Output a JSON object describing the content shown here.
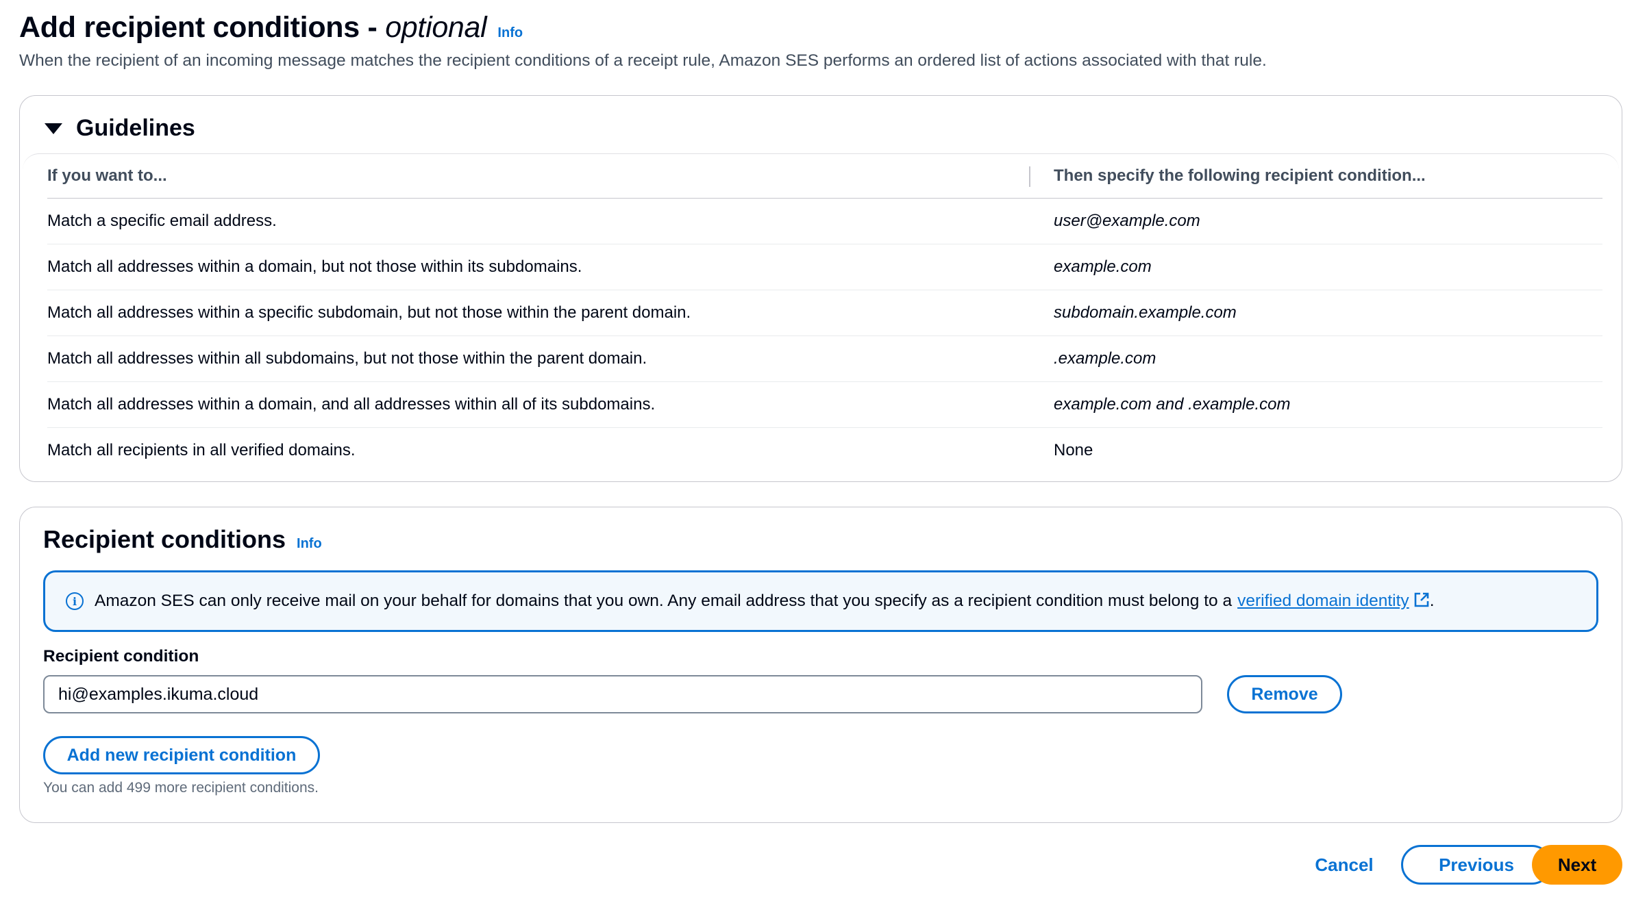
{
  "header": {
    "title_main": "Add recipient conditions - ",
    "title_optional": "optional",
    "info_label": "Info",
    "description": "When the recipient of an incoming message matches the recipient conditions of a receipt rule, Amazon SES performs an ordered list of actions associated with that rule."
  },
  "guidelines": {
    "title": "Guidelines",
    "columns": [
      "If you want to...",
      "Then specify the following recipient condition..."
    ],
    "rows": [
      {
        "want": "Match a specific email address.",
        "condition": "user@example.com"
      },
      {
        "want": "Match all addresses within a domain, but not those within its subdomains.",
        "condition": "example.com"
      },
      {
        "want": "Match all addresses within a specific subdomain, but not those within the parent domain.",
        "condition": "subdomain.example.com"
      },
      {
        "want": "Match all addresses within all subdomains, but not those within the parent domain.",
        "condition": ".example.com"
      },
      {
        "want": "Match all addresses within a domain, and all addresses within all of its subdomains.",
        "condition": "example.com and .example.com"
      },
      {
        "want": "Match all recipients in all verified domains.",
        "condition": "None"
      }
    ]
  },
  "conditions": {
    "title": "Recipient conditions",
    "info_label": "Info",
    "alert_text": "Amazon SES can only receive mail on your behalf for domains that you own. Any email address that you specify as a recipient condition must belong to a",
    "alert_link": "verified domain identity",
    "alert_end": ".",
    "field_label": "Recipient condition",
    "field_value": "hi@examples.ikuma.cloud",
    "remove_label": "Remove",
    "add_label": "Add new recipient condition",
    "hint": "You can add 499 more recipient conditions."
  },
  "footer": {
    "cancel_label": "Cancel",
    "previous_label": "Previous",
    "next_label": "Next"
  },
  "colors": {
    "link": "#0972d3",
    "primary_button": "#ff9900",
    "alert_background": "#f2f8fd"
  },
  "icons": [
    "caret-down-icon",
    "info-circle-icon",
    "external-link-icon"
  ]
}
